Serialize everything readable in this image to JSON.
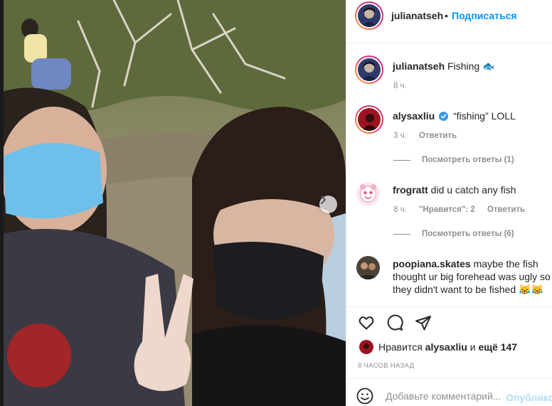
{
  "post": {
    "author": "julianatseh",
    "separator": "•",
    "follow_label": "Подписаться",
    "caption_author": "julianatseh",
    "caption_text": "Fishing 🐟",
    "caption_time": "8 ч."
  },
  "comments": [
    {
      "username": "alysaxliu",
      "verified": true,
      "text": "“fishing” LOLL",
      "time": "3 ч.",
      "reply_label": "Ответить",
      "view_replies": "Посмотреть ответы (1)"
    },
    {
      "username": "frogratt",
      "text": "did u catch any fish",
      "time": "8 ч.",
      "likes": "\"Нравится\": 2",
      "reply_label": "Ответить",
      "view_replies": "Посмотреть ответы (6)"
    },
    {
      "username": "poopiana.skates",
      "text_line1": "maybe the fish",
      "text_line2": "thought ur big forehead was ugly so",
      "text_line3": "they didn't want to be fished 😹😹"
    }
  ],
  "likes": {
    "prefix": "Нравится",
    "user": "alysaxliu",
    "conj": "и",
    "others": "ещё 147"
  },
  "time_ago": "8 ЧАСОВ НАЗАД",
  "comment_box": {
    "placeholder": "Добавьте комментарий...",
    "publish_label": "Опублико"
  },
  "icons": {
    "like": "heart-icon",
    "comment": "comment-icon",
    "share": "share-icon",
    "emoji": "emoji-icon",
    "next": "chevron-right-icon"
  },
  "colors": {
    "accent": "#0095f6",
    "publish_disabled": "#b2dffc",
    "muted": "#8e8e8e"
  }
}
